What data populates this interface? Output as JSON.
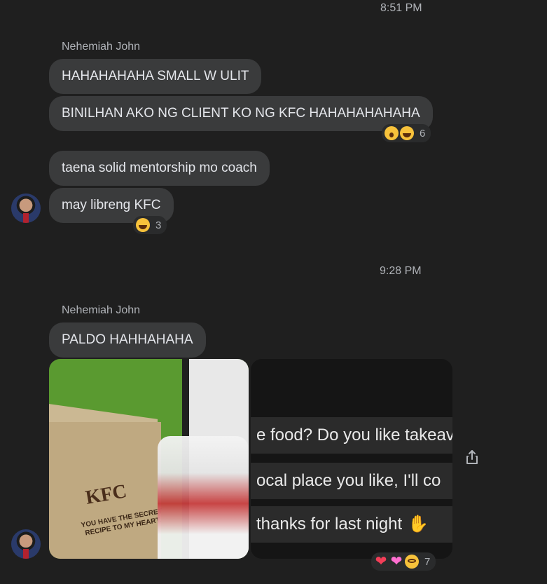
{
  "timestamps": [
    "8:51 PM",
    "9:28 PM"
  ],
  "groups": [
    {
      "sender": "Nehemiah John",
      "messages": [
        "HAHAHAHAHA SMALL W ULIT",
        "BINILHAN AKO NG CLIENT KO NG KFC HAHAHAHAHAHA"
      ],
      "reaction_count": "6"
    },
    {
      "messages": [
        "taena solid mentorship mo coach",
        "may libreng KFC"
      ],
      "reaction_count": "3"
    },
    {
      "sender": "Nehemiah John",
      "messages": [
        "PALDO HAHHAHAHA"
      ]
    }
  ],
  "photo": {
    "bag_brand": "KFC",
    "bag_slogan": "YOU HAVE THE SECRET RECIPE TO MY HEART."
  },
  "screenshot_lines": [
    "e food? Do you like takeav",
    "ocal place you like, I'll co",
    "thanks for last night"
  ],
  "photo_reaction_count": "7",
  "icons": {
    "share": "share-icon",
    "reactions_1": [
      "wow-emoji",
      "haha-emoji"
    ],
    "reactions_2": [
      "haha-emoji"
    ],
    "reactions_3": [
      "heart-emoji",
      "pink-heart-emoji",
      "crying-face-emoji"
    ],
    "pray": "folded-hands-emoji"
  },
  "colors": {
    "background": "#1f1f1f",
    "bubble": "#3a3b3c",
    "text": "#e4e6eb",
    "muted": "#b0b3b8"
  }
}
